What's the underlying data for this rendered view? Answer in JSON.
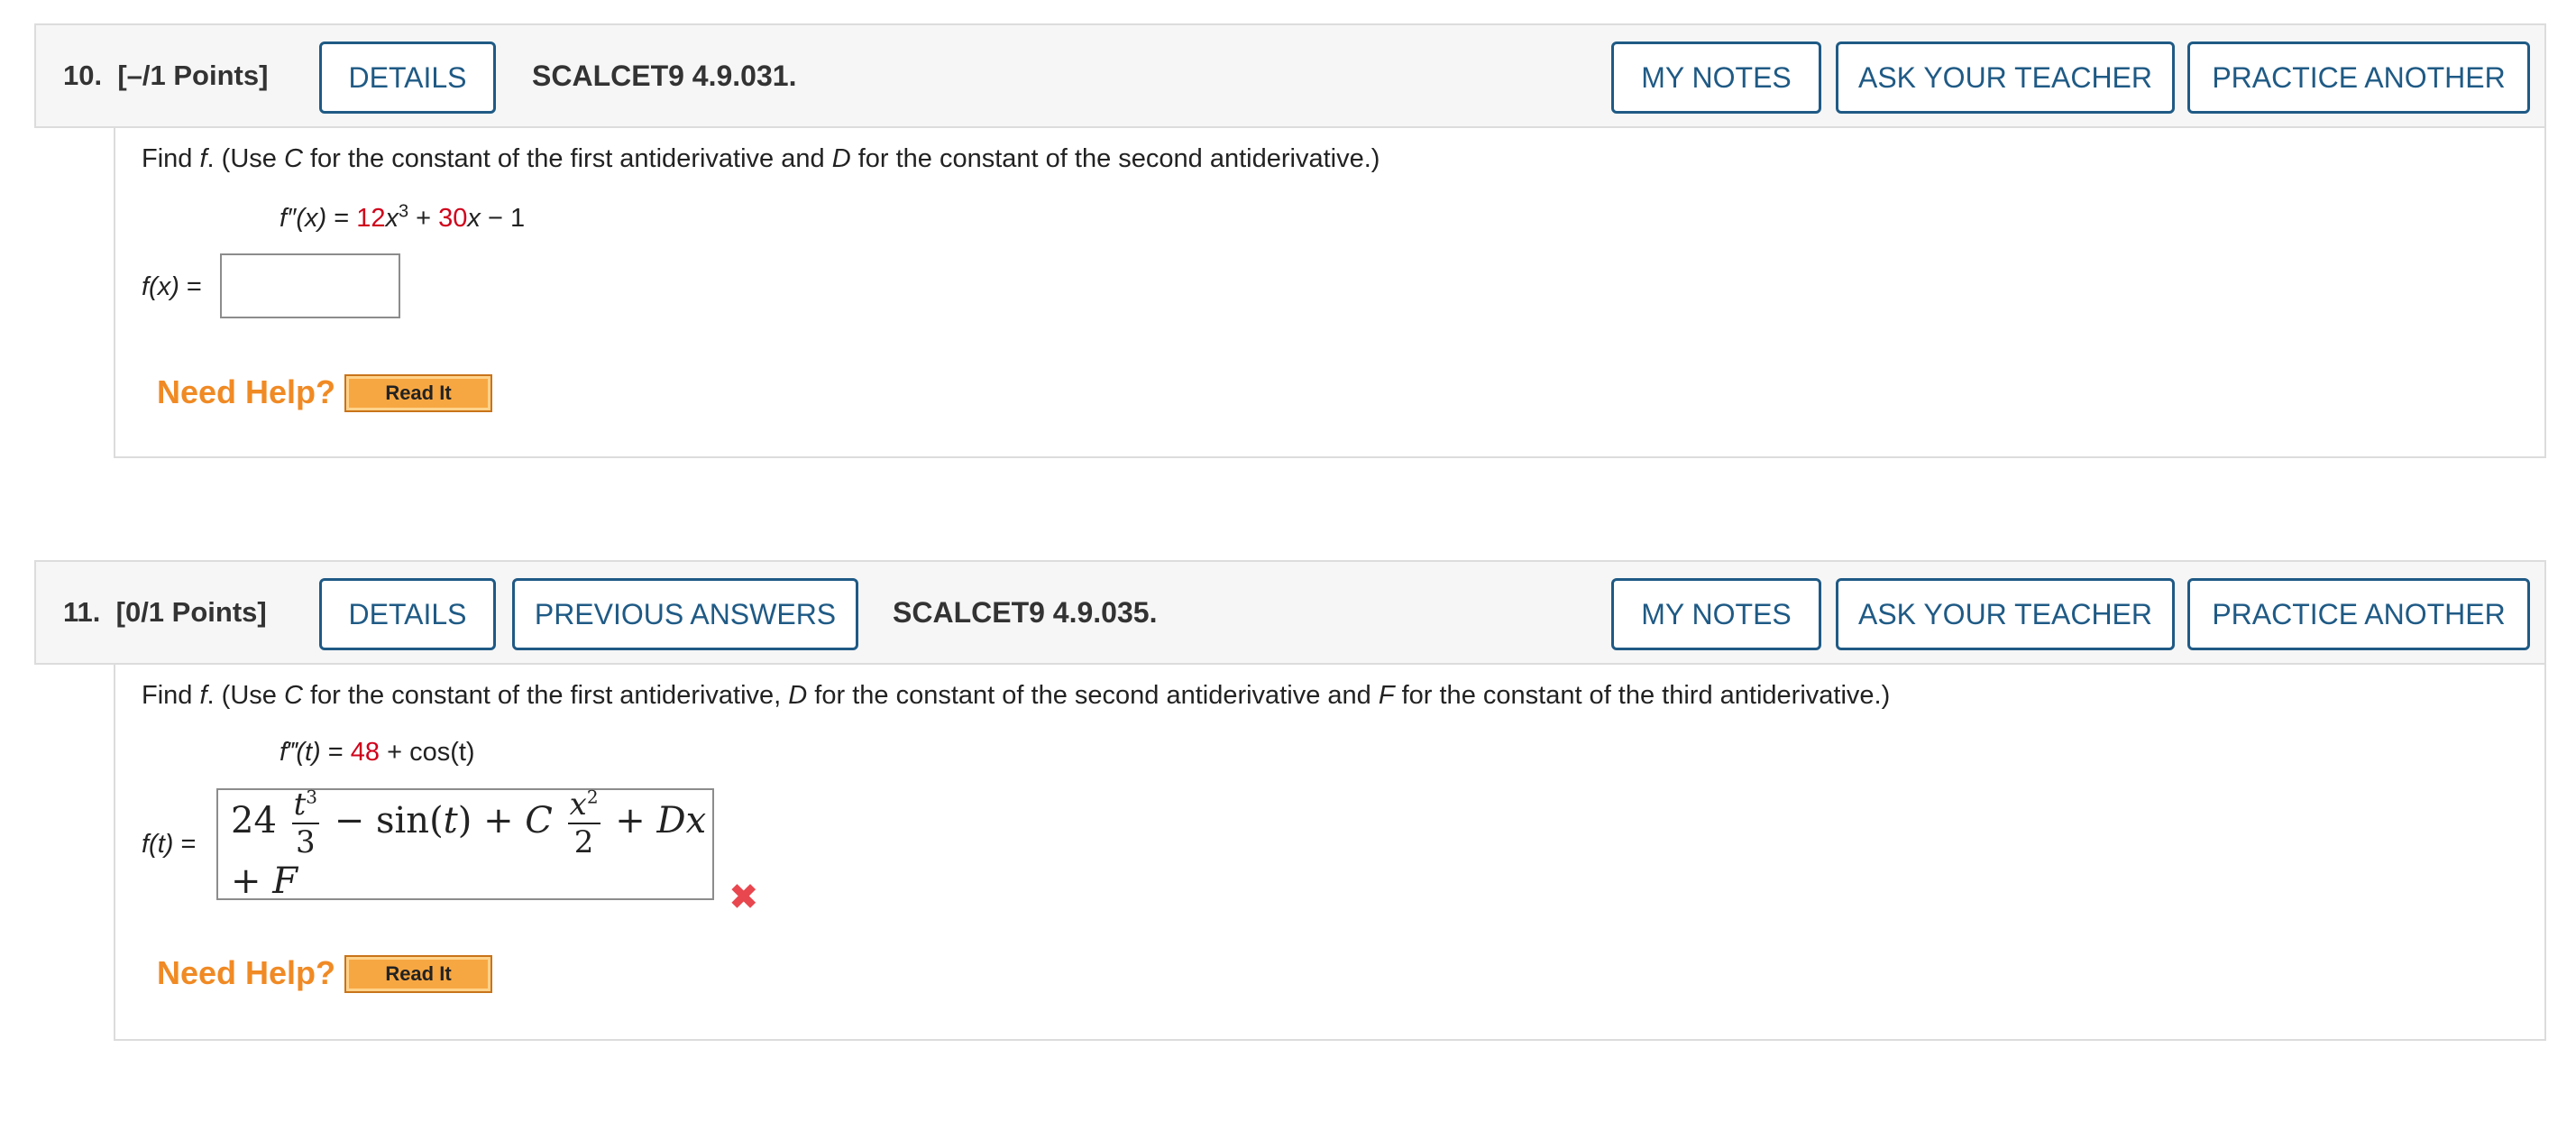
{
  "questions": [
    {
      "number": "10.",
      "points": "[–/1 Points]",
      "details_label": "DETAILS",
      "code": "SCALCET9 4.9.031.",
      "my_notes_label": "MY NOTES",
      "ask_teacher_label": "ASK YOUR TEACHER",
      "practice_label": "PRACTICE ANOTHER",
      "instruction": {
        "prefix": "Find ",
        "f": "f",
        "mid1": ". (Use ",
        "C": "C",
        "mid2": " for the constant of the first antiderivative and ",
        "D": "D",
        "mid3": " for the constant of the second antiderivative.)"
      },
      "equation": {
        "lhs": "f″(x)",
        "eq": " = ",
        "coef1": "12",
        "var1": "x",
        "exp1": "3",
        "plus": " + ",
        "coef2": "30",
        "var2": "x",
        "rest": " − 1"
      },
      "answer_label": "f(x)",
      "answer_eq": " =",
      "answer_value": "",
      "need_help": "Need Help?",
      "read_it": "Read It"
    },
    {
      "number": "11.",
      "points": "[0/1 Points]",
      "details_label": "DETAILS",
      "previous_answers_label": "PREVIOUS ANSWERS",
      "code": "SCALCET9 4.9.035.",
      "my_notes_label": "MY NOTES",
      "ask_teacher_label": "ASK YOUR TEACHER",
      "practice_label": "PRACTICE ANOTHER",
      "instruction": {
        "prefix": "Find ",
        "f": "f",
        "mid1": ". (Use ",
        "C": "C",
        "mid2": " for the constant of the first antiderivative, ",
        "D": "D",
        "mid3": " for the constant of the second antiderivative and ",
        "F": "F",
        "mid4": " for the constant of the third antiderivative.)"
      },
      "equation": {
        "lhs": "f‴(t)",
        "eq": " = ",
        "coef1": "48",
        "rest": " + cos(t)"
      },
      "answer_label": "f(t)",
      "answer_eq": " =",
      "answer_math": {
        "coef": "24",
        "frac1_num": "t",
        "frac1_num_exp": "3",
        "frac1_den": "3",
        "mid": " − sin",
        "paren_open": "(",
        "arg": "t",
        "paren_close": ")",
        "plus_c": " + C",
        "frac2_num": "x",
        "frac2_num_exp": "2",
        "frac2_den": "2",
        "tail": " + Dx + F"
      },
      "incorrect_icon": "close-icon",
      "need_help": "Need Help?",
      "read_it": "Read It"
    }
  ],
  "colors": {
    "button_border": "#1f5a85",
    "highlight_red": "#d0021b",
    "need_help_orange": "#f08a24",
    "incorrect_red": "#e8474f"
  }
}
